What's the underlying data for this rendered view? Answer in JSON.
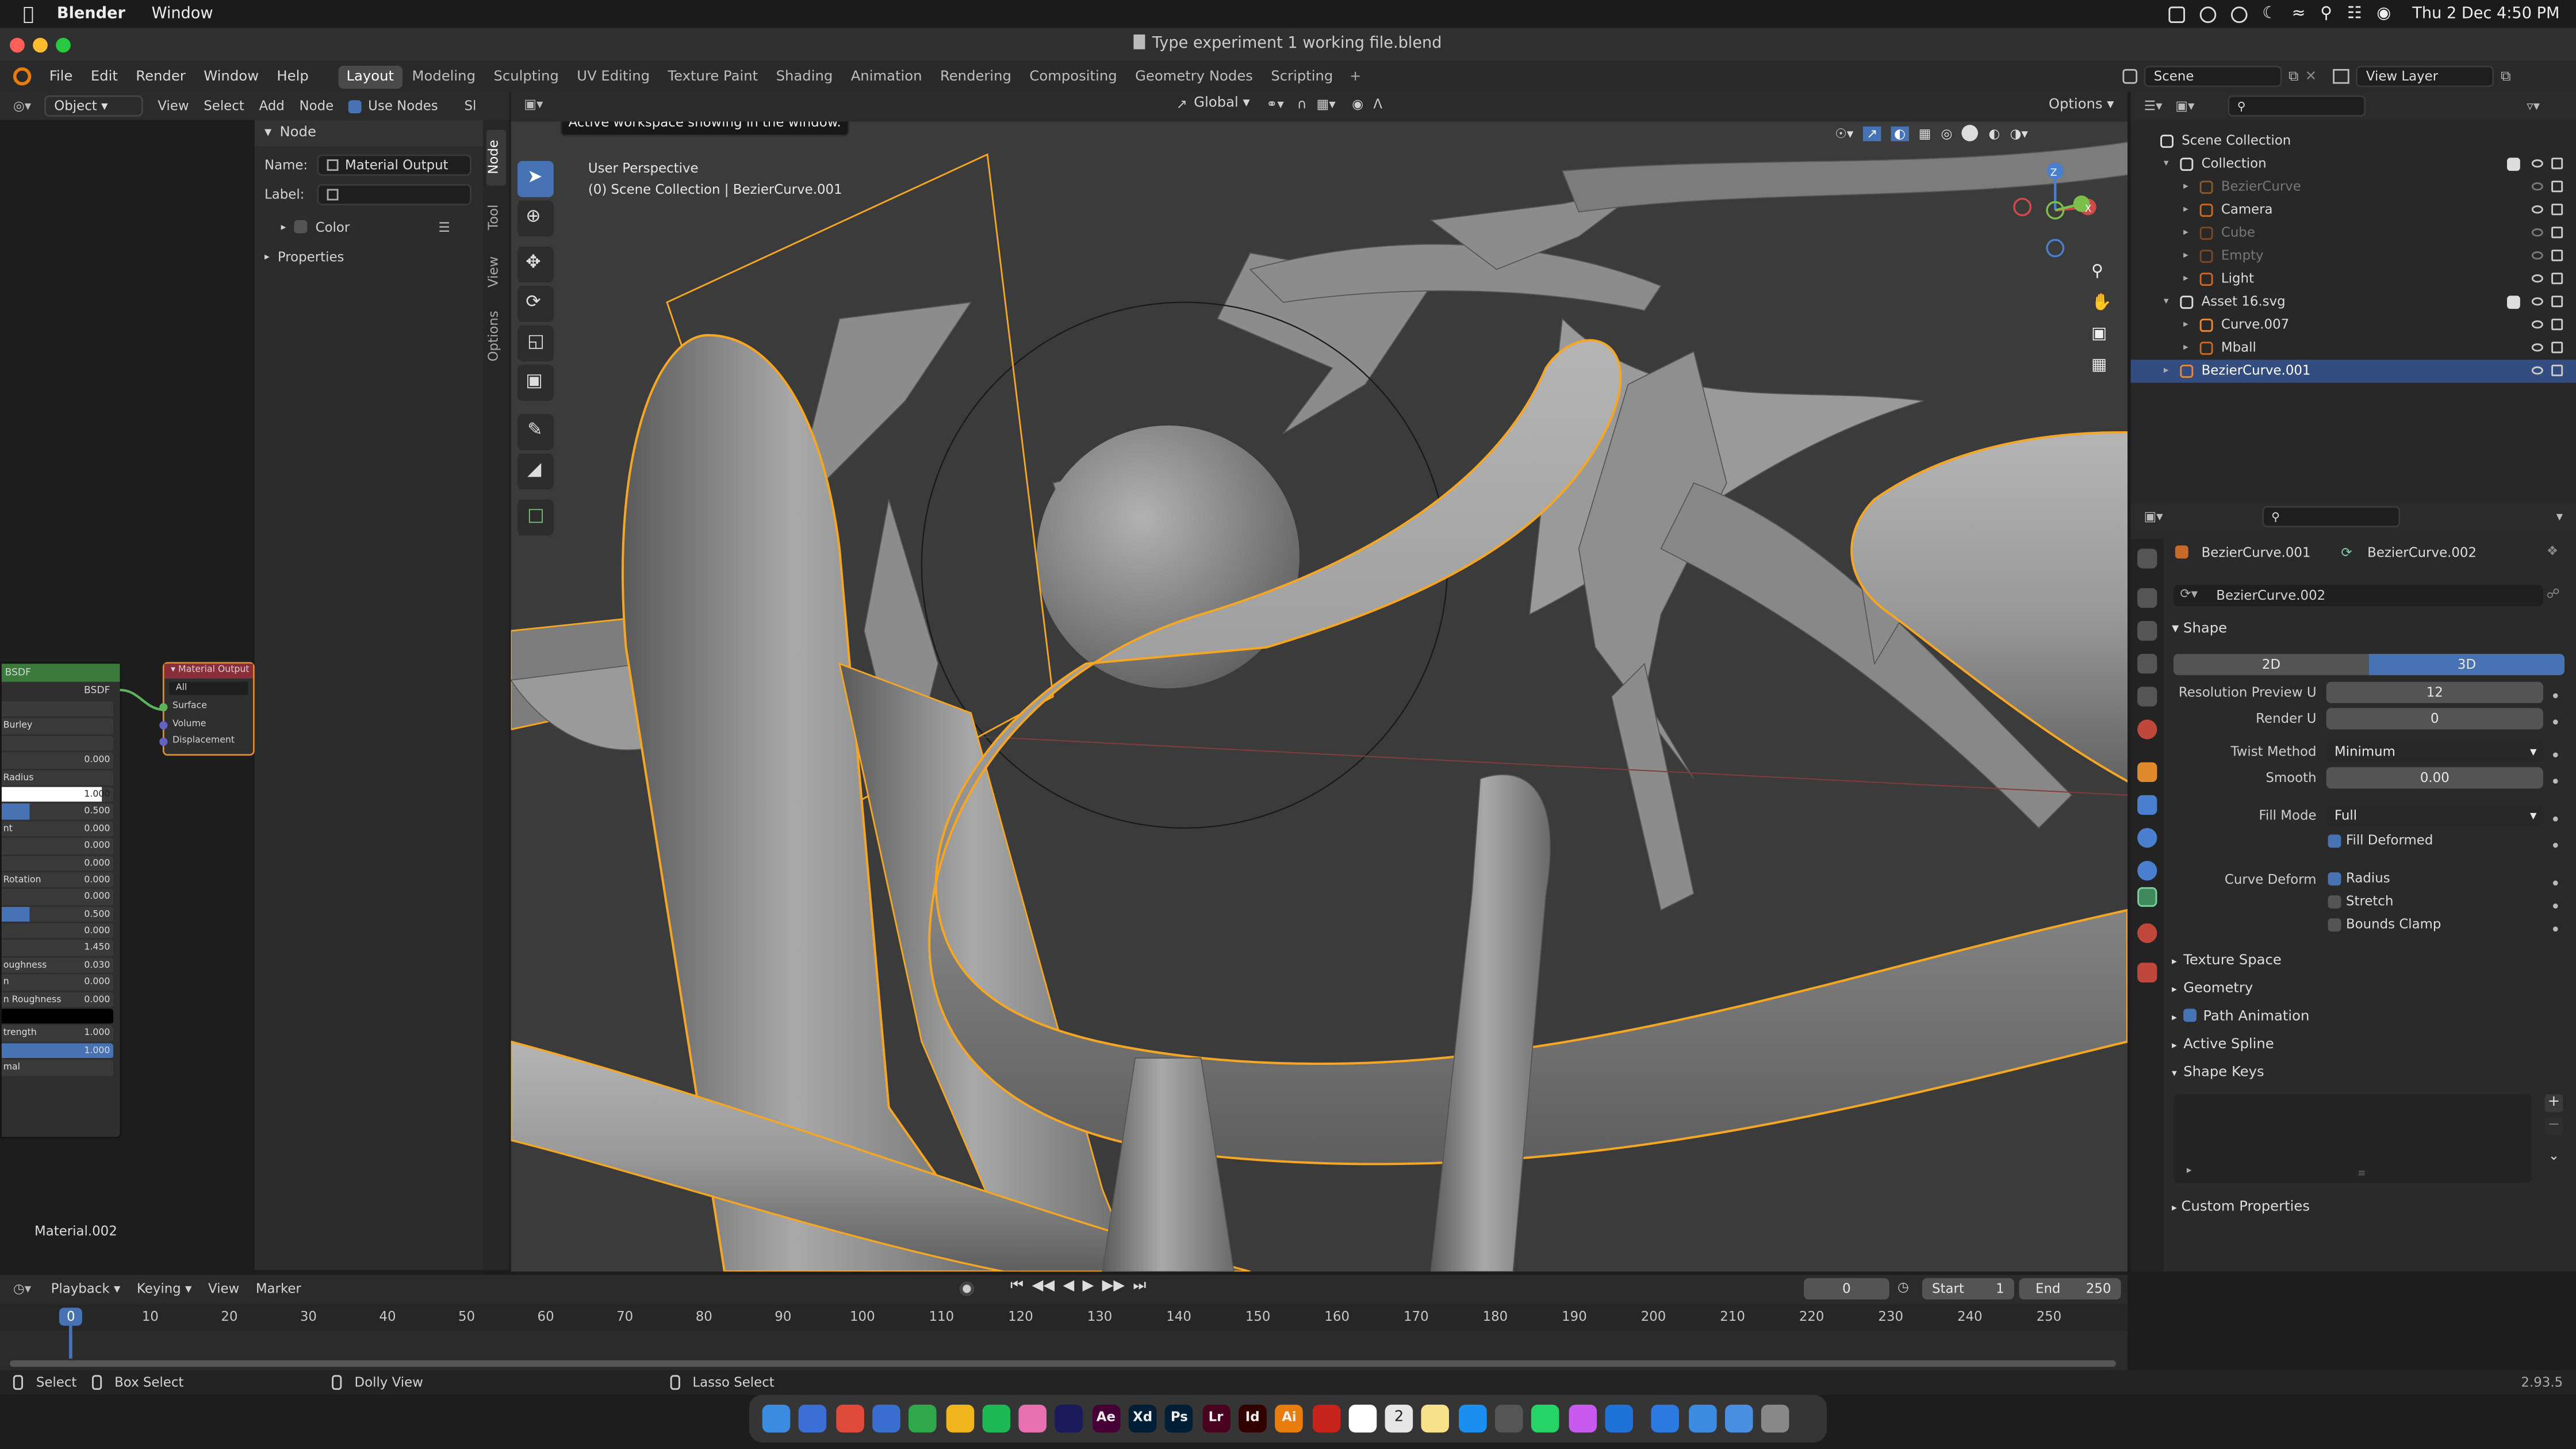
{
  "macos": {
    "app_name": "Blender",
    "menu_window": "Window",
    "datetime": "Thu 2 Dec  4:50 PM"
  },
  "window": {
    "title": "Type experiment 1 working file.blend"
  },
  "menus": [
    "File",
    "Edit",
    "Render",
    "Window",
    "Help"
  ],
  "workspaces": [
    "Layout",
    "Modeling",
    "Sculpting",
    "UV Editing",
    "Texture Paint",
    "Shading",
    "Animation",
    "Rendering",
    "Compositing",
    "Geometry Nodes",
    "Scripting"
  ],
  "active_workspace": "Layout",
  "scene_selector": {
    "scene": "Scene",
    "view_layer": "View Layer"
  },
  "node_editor": {
    "mode": "Object",
    "menus": [
      "View",
      "Select",
      "Add",
      "Node"
    ],
    "use_nodes_label": "Use Nodes",
    "slot_label": "Sl",
    "sidebar_tabs": [
      "Node",
      "Tool",
      "View",
      "Options"
    ],
    "panel_title": "Node",
    "name_label": "Name:",
    "name_value": "Material Output",
    "label_label": "Label:",
    "color_label": "Color",
    "properties_label": "Properties",
    "material_name": "Material.002",
    "bsdf_node": {
      "header": "BSDF",
      "output": "BSDF",
      "rows": [
        {
          "label": "",
          "value": ""
        },
        {
          "label": "Burley",
          "value": ""
        },
        {
          "label": "",
          "value": ""
        },
        {
          "label": "",
          "value": "0.000"
        },
        {
          "label": "Radius",
          "value": ""
        },
        {
          "label": "",
          "value": "1.000"
        },
        {
          "label": "",
          "value": "0.500"
        },
        {
          "label": "nt",
          "value": "0.000"
        },
        {
          "label": "",
          "value": "0.000"
        },
        {
          "label": "",
          "value": "0.000"
        },
        {
          "label": "Rotation",
          "value": "0.000"
        },
        {
          "label": "",
          "value": "0.000"
        },
        {
          "label": "",
          "value": "0.500"
        },
        {
          "label": "",
          "value": "0.000"
        },
        {
          "label": "",
          "value": "1.450"
        },
        {
          "label": "oughness",
          "value": "0.030"
        },
        {
          "label": "n",
          "value": "0.000"
        },
        {
          "label": "n Roughness",
          "value": "0.000"
        },
        {
          "label": "",
          "value": ""
        },
        {
          "label": "trength",
          "value": "1.000"
        },
        {
          "label": "",
          "value": "1.000"
        },
        {
          "label": "mal",
          "value": ""
        }
      ]
    },
    "output_node": {
      "header": "Material Output",
      "target": "All",
      "sockets": [
        "Surface",
        "Volume",
        "Displacement"
      ]
    }
  },
  "viewport": {
    "tooltip": "Active workspace showing in the window.",
    "perspective": "User Perspective",
    "collection_info": "(0) Scene Collection | BezierCurve.001",
    "transform_orientation": "Global",
    "options_label": "Options",
    "gizmo_axes": [
      "X",
      "Y",
      "Z"
    ]
  },
  "outliner": {
    "rows": [
      {
        "name": "Scene Collection",
        "indent": 0,
        "kind": "collection",
        "selected": false,
        "dim": false
      },
      {
        "name": "Collection",
        "indent": 1,
        "kind": "collection",
        "selected": false,
        "dim": false,
        "checkbox": true
      },
      {
        "name": "BezierCurve",
        "indent": 2,
        "kind": "curve",
        "selected": false,
        "dim": true
      },
      {
        "name": "Camera",
        "indent": 2,
        "kind": "camera",
        "selected": false,
        "dim": false
      },
      {
        "name": "Cube",
        "indent": 2,
        "kind": "mesh",
        "selected": false,
        "dim": true
      },
      {
        "name": "Empty",
        "indent": 2,
        "kind": "empty",
        "selected": false,
        "dim": true
      },
      {
        "name": "Light",
        "indent": 2,
        "kind": "light",
        "selected": false,
        "dim": false
      },
      {
        "name": "Asset 16.svg",
        "indent": 1,
        "kind": "collection",
        "selected": false,
        "dim": false,
        "checkbox": true
      },
      {
        "name": "Curve.007",
        "indent": 2,
        "kind": "curve",
        "selected": false,
        "dim": false
      },
      {
        "name": "Mball",
        "indent": 2,
        "kind": "meta",
        "selected": false,
        "dim": false
      },
      {
        "name": "BezierCurve.001",
        "indent": 1,
        "kind": "curve",
        "selected": true,
        "dim": false
      }
    ]
  },
  "properties": {
    "object_name": "BezierCurve.001",
    "data_name": "BezierCurve.002",
    "datablock": "BezierCurve.002",
    "shape_section": "Shape",
    "dim_2d": "2D",
    "dim_3d": "3D",
    "resolution_preview_label": "Resolution Preview U",
    "resolution_preview_value": "12",
    "render_u_label": "Render U",
    "render_u_value": "0",
    "twist_method_label": "Twist Method",
    "twist_method_value": "Minimum",
    "smooth_label": "Smooth",
    "smooth_value": "0.00",
    "fill_mode_label": "Fill Mode",
    "fill_mode_value": "Full",
    "fill_deformed_label": "Fill Deformed",
    "curve_deform_label": "Curve Deform",
    "radius_label": "Radius",
    "stretch_label": "Stretch",
    "bounds_clamp_label": "Bounds Clamp",
    "sections": [
      "Texture Space",
      "Geometry",
      "Path Animation",
      "Active Spline",
      "Shape Keys"
    ],
    "custom_properties": "Custom Properties"
  },
  "timeline": {
    "menus": [
      "Playback",
      "Keying",
      "View",
      "Marker"
    ],
    "current_frame": "0",
    "start_label": "Start",
    "start_value": "1",
    "end_label": "End",
    "end_value": "250",
    "ruler": [
      "0",
      "10",
      "20",
      "30",
      "40",
      "50",
      "60",
      "70",
      "80",
      "90",
      "100",
      "110",
      "120",
      "130",
      "140",
      "150",
      "160",
      "170",
      "180",
      "190",
      "200",
      "210",
      "220",
      "230",
      "240",
      "250"
    ]
  },
  "status": {
    "select": "Select",
    "box_select": "Box Select",
    "dolly_view": "Dolly View",
    "lasso_select": "Lasso Select",
    "version": "2.93.5"
  },
  "dock": {
    "labels": [
      "Ae",
      "Xd",
      "Ps",
      "Lr",
      "Id",
      "Ai"
    ],
    "calendar_day": "2"
  },
  "colors": {
    "accent": "#4772b3",
    "selection_outline": "#f5a623",
    "viewport_bg": "#3b3b3b",
    "bsdf_header": "#3a7a3a",
    "output_header": "#8a2e3a"
  }
}
